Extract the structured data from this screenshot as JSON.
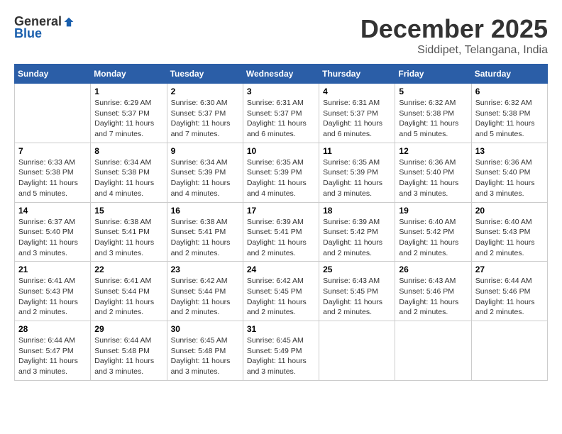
{
  "header": {
    "logo": {
      "general": "General",
      "blue": "Blue"
    },
    "title": "December 2025",
    "subtitle": "Siddipet, Telangana, India"
  },
  "calendar": {
    "days_of_week": [
      "Sunday",
      "Monday",
      "Tuesday",
      "Wednesday",
      "Thursday",
      "Friday",
      "Saturday"
    ],
    "weeks": [
      [
        {
          "day": "",
          "info": ""
        },
        {
          "day": "1",
          "info": "Sunrise: 6:29 AM\nSunset: 5:37 PM\nDaylight: 11 hours\nand 7 minutes."
        },
        {
          "day": "2",
          "info": "Sunrise: 6:30 AM\nSunset: 5:37 PM\nDaylight: 11 hours\nand 7 minutes."
        },
        {
          "day": "3",
          "info": "Sunrise: 6:31 AM\nSunset: 5:37 PM\nDaylight: 11 hours\nand 6 minutes."
        },
        {
          "day": "4",
          "info": "Sunrise: 6:31 AM\nSunset: 5:37 PM\nDaylight: 11 hours\nand 6 minutes."
        },
        {
          "day": "5",
          "info": "Sunrise: 6:32 AM\nSunset: 5:38 PM\nDaylight: 11 hours\nand 5 minutes."
        },
        {
          "day": "6",
          "info": "Sunrise: 6:32 AM\nSunset: 5:38 PM\nDaylight: 11 hours\nand 5 minutes."
        }
      ],
      [
        {
          "day": "7",
          "info": "Sunrise: 6:33 AM\nSunset: 5:38 PM\nDaylight: 11 hours\nand 5 minutes."
        },
        {
          "day": "8",
          "info": "Sunrise: 6:34 AM\nSunset: 5:38 PM\nDaylight: 11 hours\nand 4 minutes."
        },
        {
          "day": "9",
          "info": "Sunrise: 6:34 AM\nSunset: 5:39 PM\nDaylight: 11 hours\nand 4 minutes."
        },
        {
          "day": "10",
          "info": "Sunrise: 6:35 AM\nSunset: 5:39 PM\nDaylight: 11 hours\nand 4 minutes."
        },
        {
          "day": "11",
          "info": "Sunrise: 6:35 AM\nSunset: 5:39 PM\nDaylight: 11 hours\nand 3 minutes."
        },
        {
          "day": "12",
          "info": "Sunrise: 6:36 AM\nSunset: 5:40 PM\nDaylight: 11 hours\nand 3 minutes."
        },
        {
          "day": "13",
          "info": "Sunrise: 6:36 AM\nSunset: 5:40 PM\nDaylight: 11 hours\nand 3 minutes."
        }
      ],
      [
        {
          "day": "14",
          "info": "Sunrise: 6:37 AM\nSunset: 5:40 PM\nDaylight: 11 hours\nand 3 minutes."
        },
        {
          "day": "15",
          "info": "Sunrise: 6:38 AM\nSunset: 5:41 PM\nDaylight: 11 hours\nand 3 minutes."
        },
        {
          "day": "16",
          "info": "Sunrise: 6:38 AM\nSunset: 5:41 PM\nDaylight: 11 hours\nand 2 minutes."
        },
        {
          "day": "17",
          "info": "Sunrise: 6:39 AM\nSunset: 5:41 PM\nDaylight: 11 hours\nand 2 minutes."
        },
        {
          "day": "18",
          "info": "Sunrise: 6:39 AM\nSunset: 5:42 PM\nDaylight: 11 hours\nand 2 minutes."
        },
        {
          "day": "19",
          "info": "Sunrise: 6:40 AM\nSunset: 5:42 PM\nDaylight: 11 hours\nand 2 minutes."
        },
        {
          "day": "20",
          "info": "Sunrise: 6:40 AM\nSunset: 5:43 PM\nDaylight: 11 hours\nand 2 minutes."
        }
      ],
      [
        {
          "day": "21",
          "info": "Sunrise: 6:41 AM\nSunset: 5:43 PM\nDaylight: 11 hours\nand 2 minutes."
        },
        {
          "day": "22",
          "info": "Sunrise: 6:41 AM\nSunset: 5:44 PM\nDaylight: 11 hours\nand 2 minutes."
        },
        {
          "day": "23",
          "info": "Sunrise: 6:42 AM\nSunset: 5:44 PM\nDaylight: 11 hours\nand 2 minutes."
        },
        {
          "day": "24",
          "info": "Sunrise: 6:42 AM\nSunset: 5:45 PM\nDaylight: 11 hours\nand 2 minutes."
        },
        {
          "day": "25",
          "info": "Sunrise: 6:43 AM\nSunset: 5:45 PM\nDaylight: 11 hours\nand 2 minutes."
        },
        {
          "day": "26",
          "info": "Sunrise: 6:43 AM\nSunset: 5:46 PM\nDaylight: 11 hours\nand 2 minutes."
        },
        {
          "day": "27",
          "info": "Sunrise: 6:44 AM\nSunset: 5:46 PM\nDaylight: 11 hours\nand 2 minutes."
        }
      ],
      [
        {
          "day": "28",
          "info": "Sunrise: 6:44 AM\nSunset: 5:47 PM\nDaylight: 11 hours\nand 3 minutes."
        },
        {
          "day": "29",
          "info": "Sunrise: 6:44 AM\nSunset: 5:48 PM\nDaylight: 11 hours\nand 3 minutes."
        },
        {
          "day": "30",
          "info": "Sunrise: 6:45 AM\nSunset: 5:48 PM\nDaylight: 11 hours\nand 3 minutes."
        },
        {
          "day": "31",
          "info": "Sunrise: 6:45 AM\nSunset: 5:49 PM\nDaylight: 11 hours\nand 3 minutes."
        },
        {
          "day": "",
          "info": ""
        },
        {
          "day": "",
          "info": ""
        },
        {
          "day": "",
          "info": ""
        }
      ]
    ]
  }
}
